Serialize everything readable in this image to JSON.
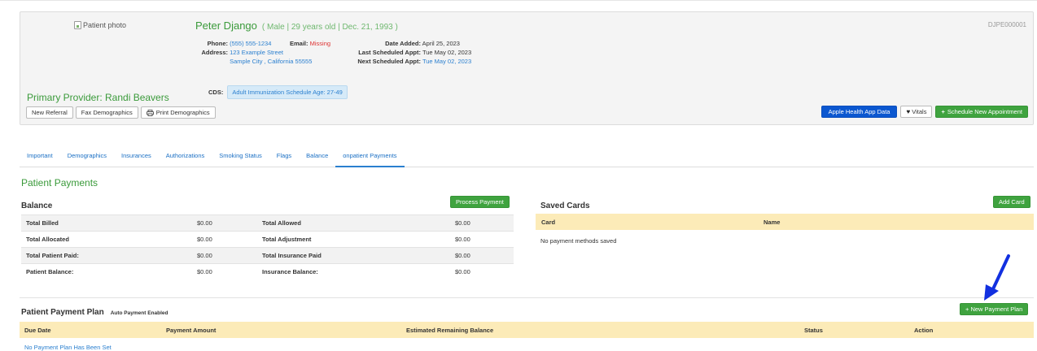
{
  "patient": {
    "photo_alt": "Patient photo",
    "name": "Peter Django",
    "demographics": "( Male | 29 years old | Dec. 21, 1993 )",
    "id": "DJPE000001",
    "phone_label": "Phone:",
    "phone": "(555) 555-1234",
    "email_label": "Email:",
    "email": "Missing",
    "address_label": "Address:",
    "address_line1": "123 Example Street",
    "address_line2": "Sample City , California 55555",
    "date_added_label": "Date Added:",
    "date_added": "April 25, 2023",
    "last_appt_label": "Last Scheduled Appt:",
    "last_appt": "Tue May 02, 2023",
    "next_appt_label": "Next Scheduled Appt:",
    "next_appt": "Tue May 02, 2023",
    "cds_label": "CDS:",
    "cds_badge": "Adult Immunization Schedule Age: 27-49",
    "primary_provider": "Primary Provider: Randi Beavers"
  },
  "actions": {
    "new_referral": "New Referral",
    "fax_demographics": "Fax Demographics",
    "print_demographics": "Print Demographics",
    "apple_health": "Apple Health App Data",
    "vitals": "Vitals",
    "schedule_new": "Schedule New Appointment"
  },
  "tabs": [
    {
      "label": "Important"
    },
    {
      "label": "Demographics"
    },
    {
      "label": "Insurances"
    },
    {
      "label": "Authorizations"
    },
    {
      "label": "Smoking Status"
    },
    {
      "label": "Flags"
    },
    {
      "label": "Balance"
    },
    {
      "label": "onpatient Payments"
    }
  ],
  "section_title": "Patient Payments",
  "balance": {
    "title": "Balance",
    "process_payment": "Process Payment",
    "rows": [
      {
        "l1": "Total Billed",
        "v1": "$0.00",
        "l2": "Total Allowed",
        "v2": "$0.00"
      },
      {
        "l1": "Total Allocated",
        "v1": "$0.00",
        "l2": "Total Adjustment",
        "v2": "$0.00"
      },
      {
        "l1": "Total Patient Paid:",
        "v1": "$0.00",
        "l2": "Total Insurance Paid",
        "v2": "$0.00"
      },
      {
        "l1": "Patient Balance:",
        "v1": "$0.00",
        "l2": "Insurance Balance:",
        "v2": "$0.00"
      }
    ]
  },
  "saved_cards": {
    "title": "Saved Cards",
    "add_card": "Add Card",
    "col_card": "Card",
    "col_name": "Name",
    "empty": "No payment methods saved"
  },
  "payment_plan": {
    "title": "Patient Payment Plan",
    "auto_payment": "Auto Payment Enabled",
    "new_plan": "+ New Payment Plan",
    "col_due_date": "Due Date",
    "col_payment_amount": "Payment Amount",
    "col_remaining": "Estimated Remaining Balance",
    "col_status": "Status",
    "col_action": "Action",
    "empty": "No Payment Plan Has Been Set"
  },
  "colors": {
    "green": "#3fa33f",
    "link_blue": "#2a7fcf",
    "apple_blue": "#0b57d0",
    "header_yellow": "#fcebb8",
    "annotation_arrow": "#1230e0"
  }
}
